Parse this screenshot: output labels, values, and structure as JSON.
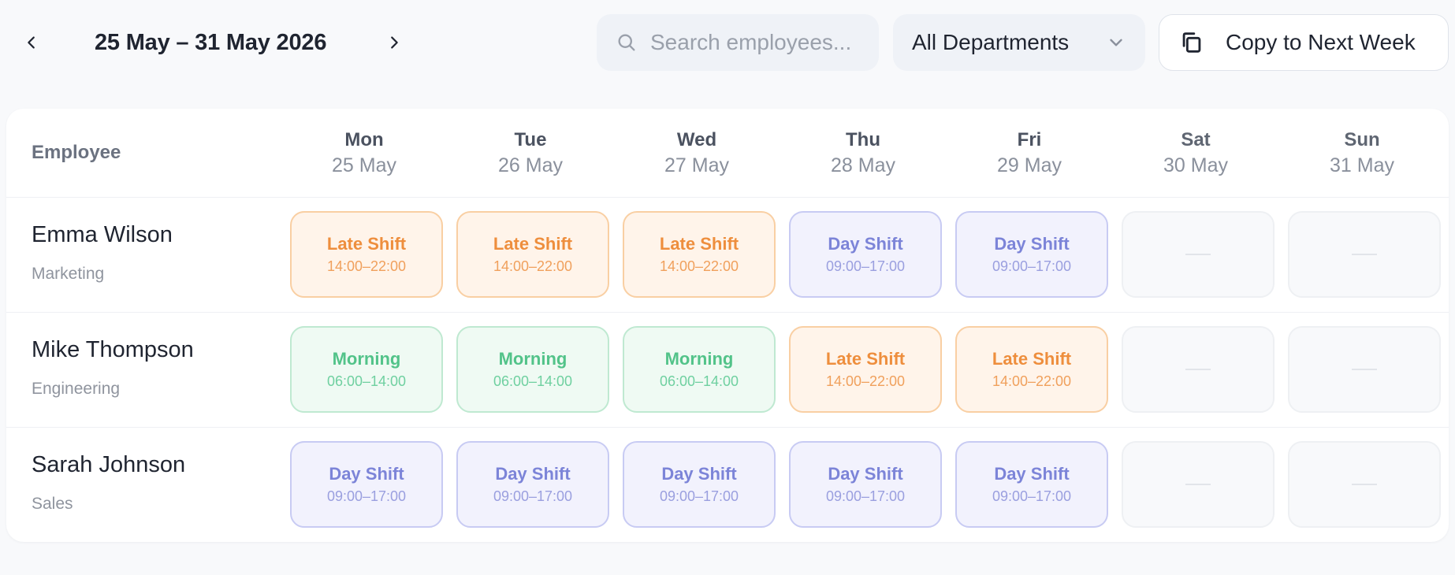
{
  "header": {
    "date_range": "25 May – 31 May 2026",
    "prev_icon": "chevron-left-icon",
    "next_icon": "chevron-right-icon",
    "search_placeholder": "Search employees...",
    "search_value": "",
    "department_selected": "All Departments",
    "copy_button_label": "Copy to Next Week"
  },
  "schedule": {
    "employee_header": "Employee",
    "days": [
      {
        "name": "Mon",
        "date": "25 May"
      },
      {
        "name": "Tue",
        "date": "26 May"
      },
      {
        "name": "Wed",
        "date": "27 May"
      },
      {
        "name": "Thu",
        "date": "28 May"
      },
      {
        "name": "Fri",
        "date": "29 May"
      },
      {
        "name": "Sat",
        "date": "30 May"
      },
      {
        "name": "Sun",
        "date": "31 May"
      }
    ],
    "employees": [
      {
        "name": "Emma Wilson",
        "department": "Marketing",
        "shifts": [
          {
            "label": "Late Shift",
            "time": "14:00–22:00"
          },
          {
            "label": "Late Shift",
            "time": "14:00–22:00"
          },
          {
            "label": "Late Shift",
            "time": "14:00–22:00"
          },
          {
            "label": "Day Shift",
            "time": "09:00–17:00"
          },
          {
            "label": "Day Shift",
            "time": "09:00–17:00"
          },
          {
            "label": "—",
            "time": ""
          },
          {
            "label": "—",
            "time": ""
          }
        ]
      },
      {
        "name": "Mike Thompson",
        "department": "Engineering",
        "shifts": [
          {
            "label": "Morning",
            "time": "06:00–14:00"
          },
          {
            "label": "Morning",
            "time": "06:00–14:00"
          },
          {
            "label": "Morning",
            "time": "06:00–14:00"
          },
          {
            "label": "Late Shift",
            "time": "14:00–22:00"
          },
          {
            "label": "Late Shift",
            "time": "14:00–22:00"
          },
          {
            "label": "—",
            "time": ""
          },
          {
            "label": "—",
            "time": ""
          }
        ]
      },
      {
        "name": "Sarah Johnson",
        "department": "Sales",
        "shifts": [
          {
            "label": "Day Shift",
            "time": "09:00–17:00"
          },
          {
            "label": "Day Shift",
            "time": "09:00–17:00"
          },
          {
            "label": "Day Shift",
            "time": "09:00–17:00"
          },
          {
            "label": "Day Shift",
            "time": "09:00–17:00"
          },
          {
            "label": "Day Shift",
            "time": "09:00–17:00"
          },
          {
            "label": "—",
            "time": ""
          },
          {
            "label": "—",
            "time": ""
          }
        ]
      }
    ]
  },
  "colors": {
    "late_shift": "#ee8e3d",
    "day_shift": "#7c84d8",
    "morning_shift": "#52c389",
    "background": "#f8f9fb"
  }
}
